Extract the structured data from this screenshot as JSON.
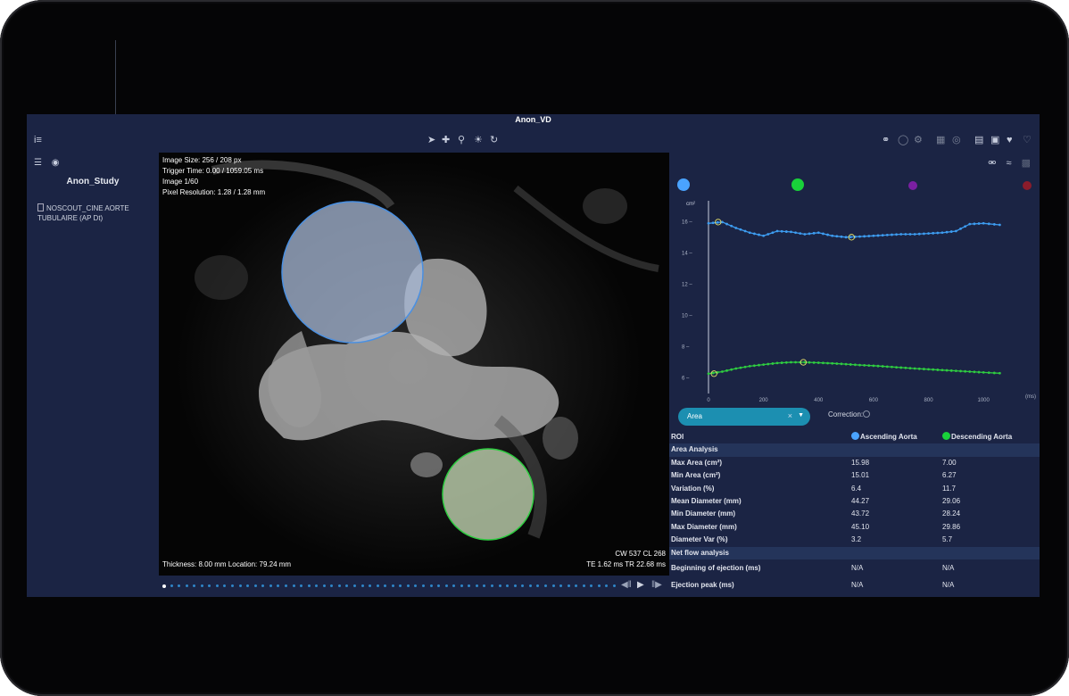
{
  "window": {
    "title": "Anon_VD"
  },
  "sidebar": {
    "study_title": "Anon_Study",
    "series": [
      {
        "label": "NOSCOUT_CINE AORTE TUBULAIRE (AP Dt)"
      }
    ]
  },
  "viewer": {
    "info_top_left": [
      "Image Size: 256 / 208 px",
      "Trigger Time: 0.00 / 1059.05 ms",
      "Image 1/60",
      "Pixel Resolution: 1.28 / 1.28 mm"
    ],
    "info_bottom_left": "Thickness: 8.00 mm Location: 79.24 mm",
    "info_bottom_right": [
      "CW 537 CL 268",
      "TE 1.62 ms TR 22.68 ms"
    ],
    "roi_colors": {
      "ascending": "#4a90e2",
      "descending": "#2ecc40"
    }
  },
  "timeline": {
    "frame_count": 60,
    "current_frame": 1
  },
  "legend": {
    "colors": [
      "#4aa3ff",
      "#19d13a",
      "#7b1fa2",
      "#8b1c2b"
    ]
  },
  "chart_data": {
    "type": "line",
    "ylabel": "cm²",
    "xlabel": "(ms)",
    "xlim": [
      0,
      1100
    ],
    "ylim": [
      5,
      17
    ],
    "xticks": [
      0,
      200,
      400,
      600,
      800,
      1000
    ],
    "yticks": [
      6,
      8,
      10,
      12,
      14,
      16
    ],
    "series": [
      {
        "color": "#3d9cf0",
        "x": [
          0,
          50,
          100,
          150,
          200,
          250,
          300,
          350,
          400,
          450,
          500,
          550,
          600,
          650,
          700,
          750,
          800,
          850,
          900,
          950,
          1000,
          1059
        ],
        "values": [
          15.9,
          15.98,
          15.6,
          15.3,
          15.1,
          15.4,
          15.35,
          15.2,
          15.3,
          15.1,
          15.01,
          15.05,
          15.1,
          15.15,
          15.2,
          15.2,
          15.25,
          15.3,
          15.4,
          15.85,
          15.9,
          15.8
        ],
        "markers": [
          {
            "x": 35,
            "y": 15.98
          },
          {
            "x": 520,
            "y": 15.01
          }
        ]
      },
      {
        "color": "#2ecc40",
        "x": [
          0,
          50,
          100,
          150,
          200,
          250,
          300,
          350,
          400,
          450,
          500,
          550,
          600,
          650,
          700,
          750,
          800,
          850,
          900,
          950,
          1000,
          1059
        ],
        "values": [
          6.27,
          6.4,
          6.6,
          6.75,
          6.85,
          6.95,
          7.0,
          7.0,
          6.97,
          6.93,
          6.88,
          6.82,
          6.78,
          6.72,
          6.66,
          6.6,
          6.55,
          6.5,
          6.45,
          6.4,
          6.35,
          6.3
        ],
        "markers": [
          {
            "x": 20,
            "y": 6.27
          },
          {
            "x": 345,
            "y": 7.0
          }
        ]
      }
    ]
  },
  "controls": {
    "parameter_value": "Area",
    "clear_glyph": "×",
    "correction_label": "Correction:"
  },
  "results": {
    "header": {
      "roi": "ROI",
      "col1": "Ascending Aorta",
      "col2": "Descending Aorta",
      "col1_color": "#4aa3ff",
      "col2_color": "#19d13a"
    },
    "area_section": "Area Analysis",
    "area_rows": [
      {
        "label": "Max Area (cm²)",
        "v1": "15.98",
        "v2": "7.00"
      },
      {
        "label": "Min Area (cm²)",
        "v1": "15.01",
        "v2": "6.27"
      },
      {
        "label": "Variation (%)",
        "v1": "6.4",
        "v2": "11.7"
      },
      {
        "label": "Mean Diameter (mm)",
        "v1": "44.27",
        "v2": "29.06"
      },
      {
        "label": "Min Diameter (mm)",
        "v1": "43.72",
        "v2": "28.24"
      },
      {
        "label": "Max Diameter (mm)",
        "v1": "45.10",
        "v2": "29.86"
      },
      {
        "label": "Diameter Var (%)",
        "v1": "3.2",
        "v2": "5.7"
      }
    ],
    "flow_section": "Net flow analysis",
    "flow_rows": [
      {
        "label": "Beginning of ejection (ms)",
        "v1": "N/A",
        "v2": "N/A"
      },
      {
        "label": "Ejection peak (ms)",
        "v1": "N/A",
        "v2": "N/A"
      }
    ]
  }
}
